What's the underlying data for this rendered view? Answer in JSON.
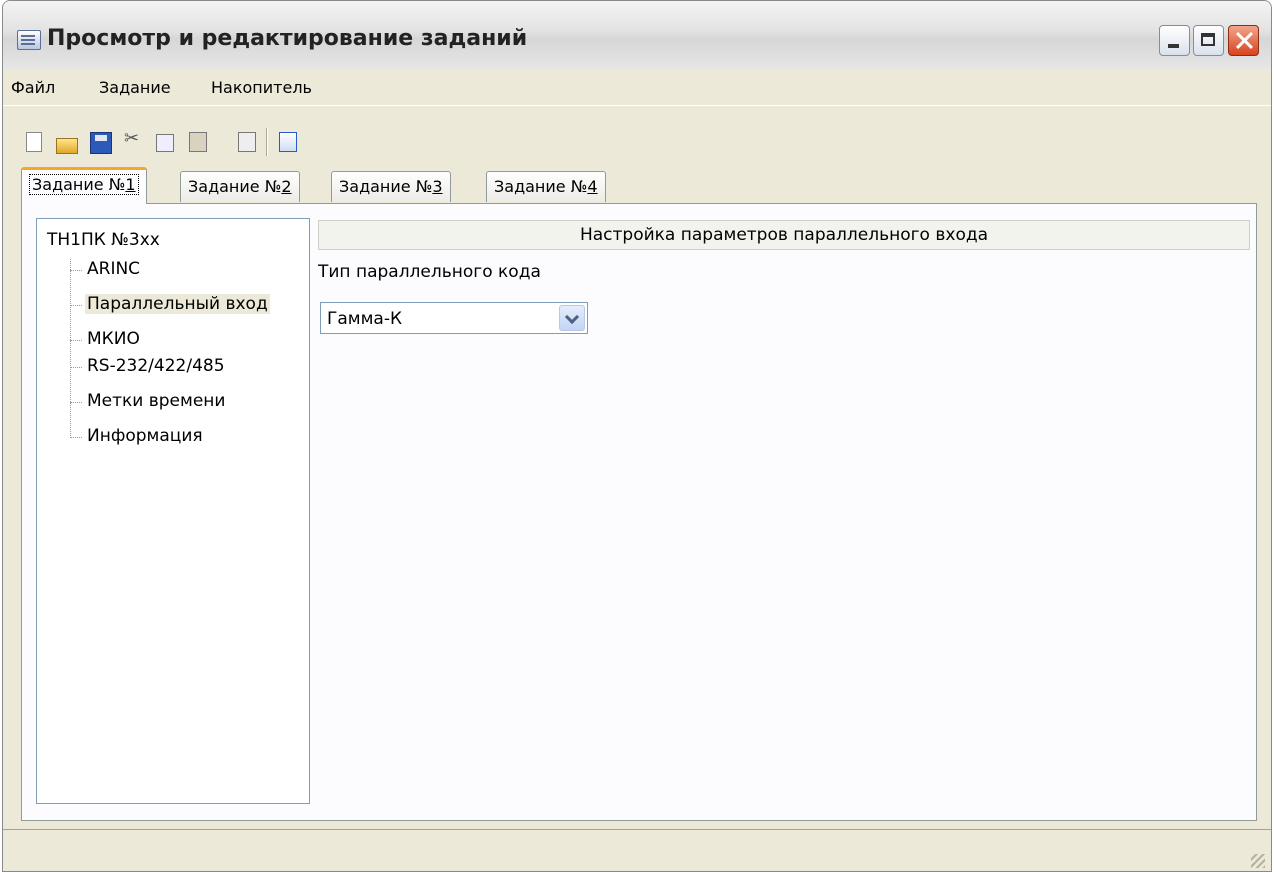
{
  "window": {
    "title": "Просмотр и редактирование заданий"
  },
  "menu": {
    "items": [
      "Файл",
      "Задание",
      "Накопитель"
    ]
  },
  "toolbar": {
    "icons": [
      "new-file-icon",
      "open-folder-icon",
      "save-icon",
      "cut-icon",
      "copy-icon",
      "paste-icon",
      "import-icon",
      "properties-icon"
    ]
  },
  "tabs": [
    {
      "prefix": "Задание №",
      "num": "1",
      "active": true
    },
    {
      "prefix": "Задание №",
      "num": "2",
      "active": false
    },
    {
      "prefix": "Задание №",
      "num": "3",
      "active": false
    },
    {
      "prefix": "Задание №",
      "num": "4",
      "active": false
    }
  ],
  "tree": {
    "root": "ТН1ПК №3хх",
    "items": [
      "ARINC",
      "Параллельный вход",
      "МКИО",
      "RS-232/422/485",
      "Метки времени",
      "Информация"
    ],
    "selected_index": 1
  },
  "panel": {
    "header": "Настройка параметров параллельного входа",
    "field_label": "Тип параллельного кода",
    "combo_value": "Гамма-К"
  },
  "colors": {
    "window_bg": "#ECE9D8",
    "active_tab_accent": "#F5A828",
    "control_border": "#7F9DB9"
  }
}
